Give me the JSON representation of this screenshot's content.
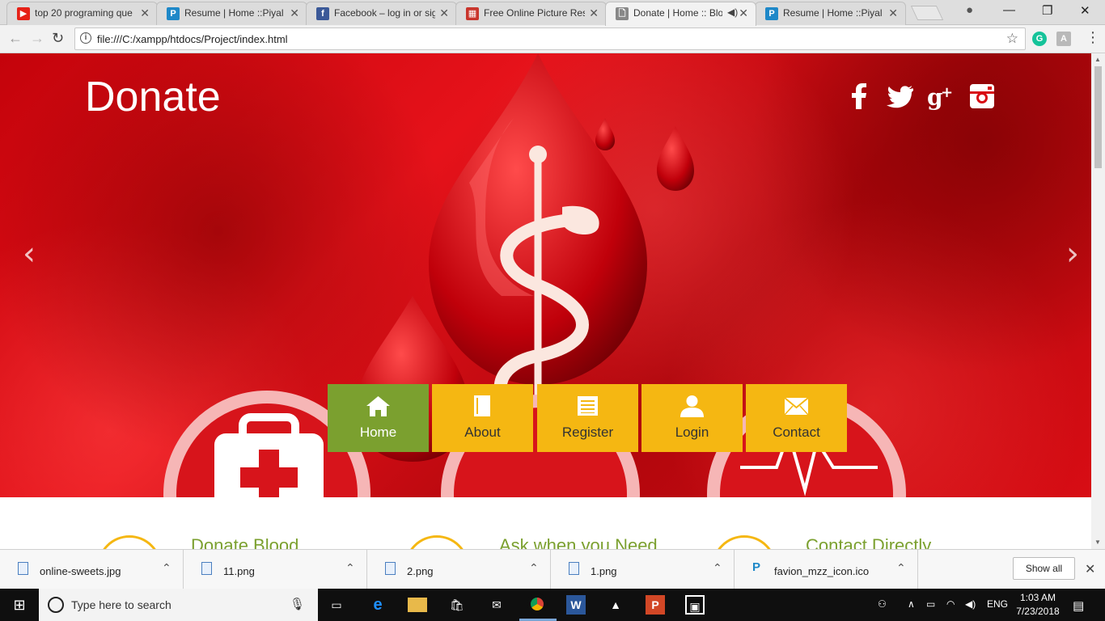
{
  "browser": {
    "tabs": [
      {
        "title": "top 20 programing que",
        "favicon": "youtube-icon",
        "color": "#e62117",
        "glyph": "▶"
      },
      {
        "title": "Resume | Home ::Piyal",
        "favicon": "p-icon",
        "color": "#1e88c8",
        "glyph": "P"
      },
      {
        "title": "Facebook – log in or sig",
        "favicon": "facebook-icon",
        "color": "#3b5998",
        "glyph": "f"
      },
      {
        "title": "Free Online Picture Res",
        "favicon": "grid-icon",
        "color": "#c9352c",
        "glyph": "▦"
      },
      {
        "title": "Donate | Home :: Blo",
        "favicon": "page-icon",
        "color": "#888888",
        "glyph": "🗋"
      },
      {
        "title": "Resume | Home ::Piyal",
        "favicon": "p-icon",
        "color": "#1e88c8",
        "glyph": "P"
      }
    ],
    "close_glyph": "✕",
    "url": "file:///C:/xampp/htdocs/Project/index.html",
    "info_glyph": "i",
    "star_glyph": "☆",
    "back_glyph": "←",
    "forward_glyph": "→",
    "reload_glyph": "↻",
    "min_glyph": "—",
    "max_glyph": "❐",
    "winclose_glyph": "✕",
    "profile_glyph": "●",
    "menu_glyph": "⋮",
    "ext1": "G",
    "ext2": "A"
  },
  "page": {
    "title": "Donate",
    "prev_arrow": "‹",
    "next_arrow": "›",
    "menu": [
      {
        "label": "Home",
        "icon": "home-icon",
        "active": true
      },
      {
        "label": "About",
        "icon": "book-icon",
        "active": false
      },
      {
        "label": "Register",
        "icon": "list-icon",
        "active": false
      },
      {
        "label": "Login",
        "icon": "user-icon",
        "active": false
      },
      {
        "label": "Contact",
        "icon": "envelope-icon",
        "active": false
      }
    ],
    "features": [
      "Donate Blood",
      "Ask when you Need",
      "Contact Directly"
    ],
    "colors": {
      "menu": "#f5b712",
      "menu_active": "#7ba02f",
      "feature": "#7ba02f",
      "hero": "#d80d14"
    }
  },
  "downloads": {
    "items": [
      "online-sweets.jpg",
      "11.png",
      "2.png",
      "1.png",
      "favion_mzz_icon.ico"
    ],
    "caret": "⌃",
    "show_all": "Show all",
    "close": "✕"
  },
  "taskbar": {
    "start_glyph": "⊞",
    "search_placeholder": "Type here to search",
    "mic": "🎙",
    "lang": "ENG",
    "time": "1:03 AM",
    "date": "7/23/2018"
  }
}
